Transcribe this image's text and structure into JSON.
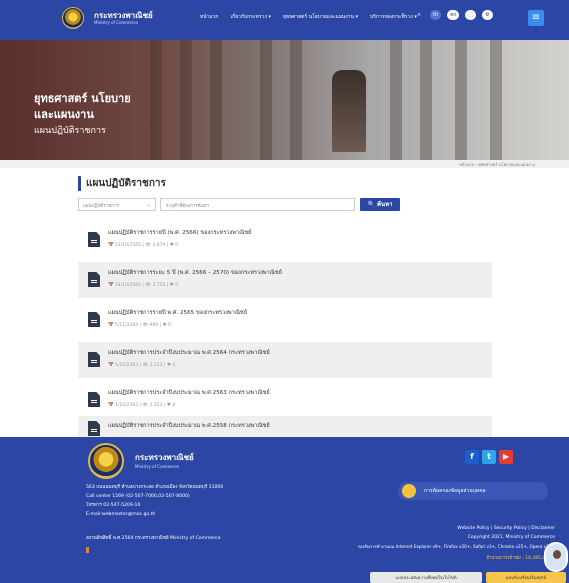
{
  "header": {
    "brand_th": "กระทรวงพาณิชย์",
    "brand_en": "Ministry of Commerce",
    "nav": [
      "หน้าแรก",
      "เกี่ยวกับกระทรวง ▾",
      "ยุทธศาสตร์ นโยบายและแผนงาน ▾",
      "บริการของกระทรวง ▾"
    ],
    "tools": [
      "ก",
      "ก",
      "th",
      "en",
      "⬚",
      "⚙"
    ],
    "menu_icon": "hamburger-icon"
  },
  "hero": {
    "title": "ยุทธศาสตร์ นโยบาย\nและแผนงาน",
    "subtitle": "แผนปฏิบัติราชการ"
  },
  "breadcrumb": "หน้าแรก › ยุทธศาสตร์ นโยบายและแผนงาน",
  "content": {
    "section_title": "แผนปฏิบัติราชการ",
    "filter_select": "แผนปฏิบัติราชการ",
    "filter_placeholder": "ระบุคำที่ต้องการค้นหา",
    "search_label": "ค้นหา",
    "documents": [
      {
        "title": "แผนปฏิบัติราชการรายปี (พ.ศ. 2566) ของกระทรวงพาณิชย์",
        "meta": "📅 31/10/2565  |  👁 4,879  |  ♥ 0"
      },
      {
        "title": "แผนปฏิบัติราชการระยะ 5 ปี (พ.ศ. 2566 – 2570) ของกระทรวงพาณิชย์",
        "meta": "📅 31/10/2565  |  👁 3,755  |  ♥ 0"
      },
      {
        "title": "แผนปฏิบัติราชการรายปี พ.ศ. 2565 ของกระทรวงพาณิชย์",
        "meta": "📅 5/11/2564  |  👁 986  |  ♥ 0"
      },
      {
        "title": "แผนปฏิบัติราชการประจำปีงบประมาณ พ.ศ.2564 กระทรวงพาณิชย์",
        "meta": "📅 1/10/2563  |  👁 1,523  |  ♥ 0"
      },
      {
        "title": "แผนปฏิบัติราชการประจำปีงบประมาณ พ.ศ.2563 กระทรวงพาณิชย์",
        "meta": "📅 1/10/2562  |  👁 1,323  |  ♥ 0"
      },
      {
        "title": "แผนปฏิบัติราชการประจำปีงบประมาณ พ.ศ.2558 กระทรวงพาณิชย์",
        "meta": ""
      }
    ]
  },
  "footer": {
    "brand_th": "กระทรวงพาณิชย์",
    "brand_en": "Ministry of Commerce",
    "address": "563 ถนนนนทบุรี ตำบลบางกระสอ อำเภอเมือง จังหวัดนนทบุรี 11000",
    "call_center": "Call center 1569 (02-507-7000,02-507-8000)",
    "phone": "โทรสาร 02-547-5209-10",
    "email": "E-mail:webmaster@moc.go.th",
    "copyright_th": "สงวนลิขสิทธิ์ พ.ศ.2564 กระทรวงพาณิชย์ Ministry of Commerce",
    "pdpa": "การคุ้มครองข้อมูลส่วนบุคคล",
    "policies": "Website Policy  |  Security Policy  |  Disclaimer",
    "copyright_en": "Copyright 2021, Ministry of Commerce",
    "browser_support": "รองรับการทำงานบน Internet Explorer v9+, Firefox v20+, Safari v3+, Chrome v25+, Opera v10+",
    "visits": "จำนวนการเข้าชม : 18,385,877",
    "bottom_button_1": "แบบประเมินความพึงพอใจเว็บไซต์",
    "bottom_button_2": "แบบร้องเรียน/ร้องทุกข์",
    "social": [
      "f",
      "t",
      "▶"
    ]
  }
}
